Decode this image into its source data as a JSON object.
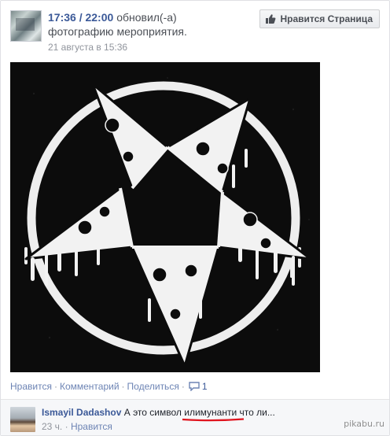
{
  "header": {
    "page_name": "17:36 / 22:00",
    "action_text": "обновил(-а)",
    "action_text_line2": "фотографию мероприятия.",
    "timestamp": "21 августа в 15:36",
    "like_page_label": "Нравится Страница"
  },
  "photo": {
    "description_icon": "pentagram-pizza-image",
    "bg_color": "#0c0c0c",
    "fg_color": "#f2f2f2"
  },
  "actions": {
    "like_label": "Нравится",
    "comment_label": "Комментарий",
    "share_label": "Поделиться",
    "comment_count": "1"
  },
  "comment": {
    "author": "Ismayil Dadashov",
    "text_before": "А это символ ",
    "underlined_word": "илимунанти",
    "text_after": " что ли...",
    "time": "23 ч.",
    "like_label": "Нравится"
  },
  "watermark": "pikabu.ru",
  "colors": {
    "link": "#3b5998",
    "action_link": "#6d84b4",
    "meta": "#90949c",
    "underline": "#e0141e"
  }
}
